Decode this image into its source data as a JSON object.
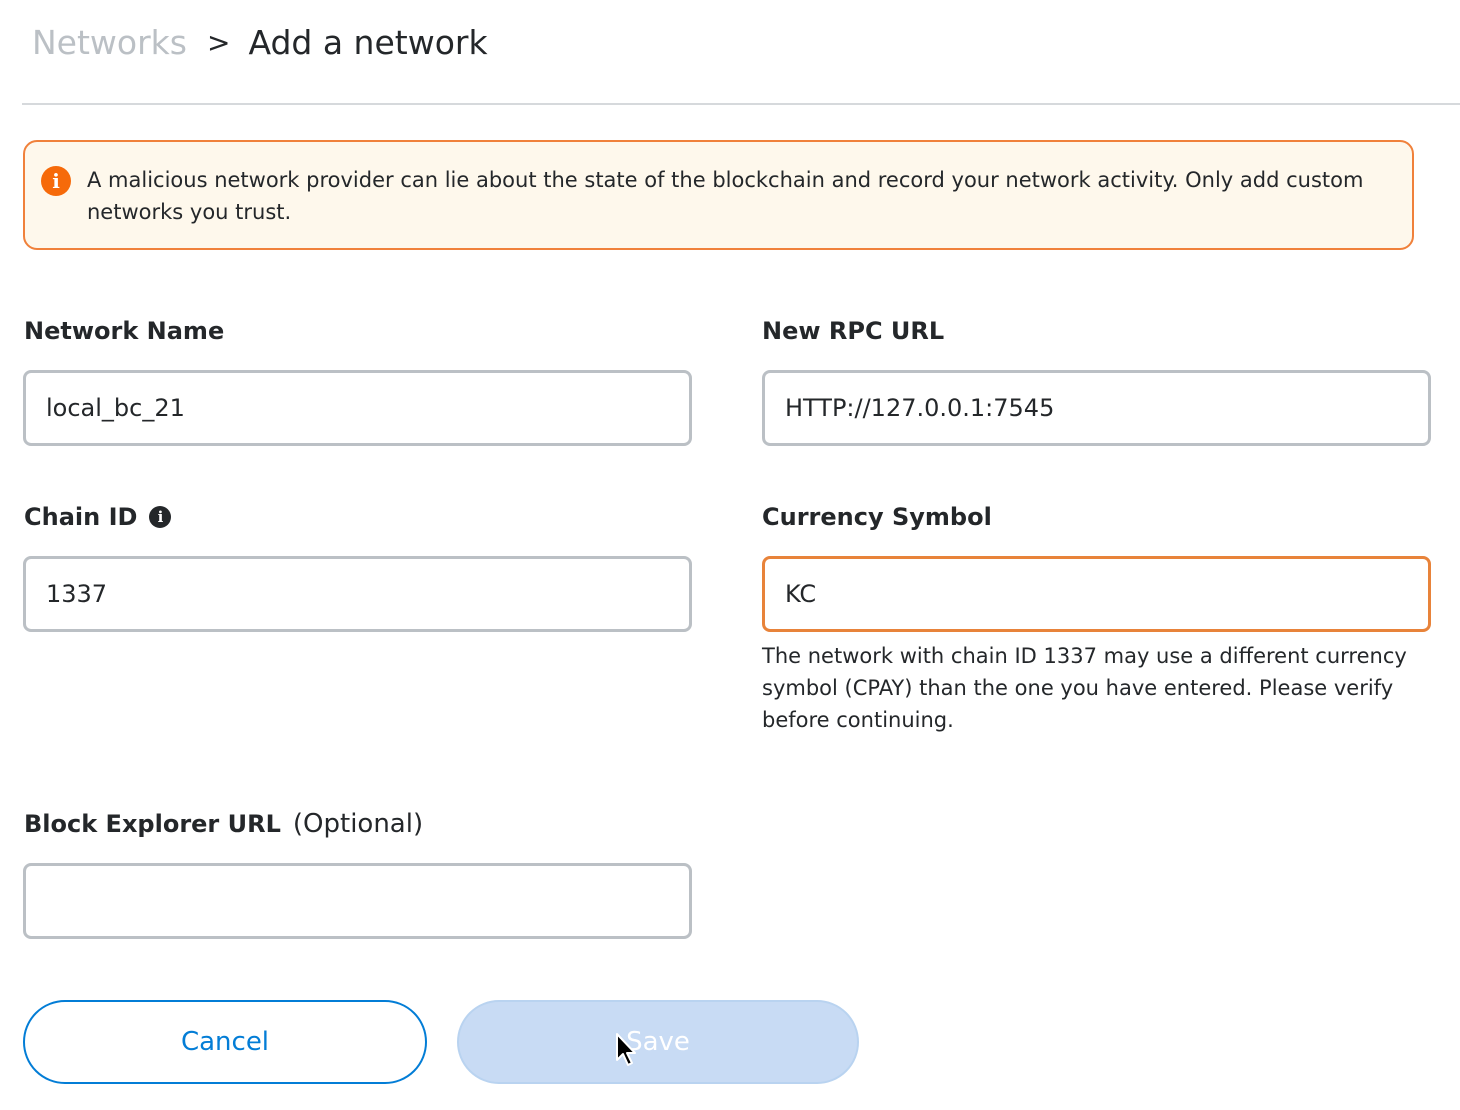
{
  "breadcrumb": {
    "parent": "Networks",
    "separator": ">",
    "current": "Add a network"
  },
  "warning": {
    "icon": "info-warning-icon",
    "text": "A malicious network provider can lie about the state of the blockchain and record your network activity. Only add custom networks you trust."
  },
  "fields": {
    "network_name": {
      "label": "Network Name",
      "value": "local_bc_21"
    },
    "rpc_url": {
      "label": "New RPC URL",
      "value": "HTTP://127.0.0.1:7545"
    },
    "chain_id": {
      "label": "Chain ID",
      "value": "1337"
    },
    "currency_symbol": {
      "label": "Currency Symbol",
      "value": "KC",
      "warning": "The network with chain ID 1337 may use a different currency symbol (CPAY) than the one you have entered. Please verify before continuing."
    },
    "block_explorer": {
      "label": "Block Explorer URL",
      "optional": "(Optional)",
      "value": ""
    }
  },
  "buttons": {
    "cancel": "Cancel",
    "save": "Save"
  },
  "colors": {
    "accent": "#037dd6",
    "warning_border": "#f0813b",
    "warning_bg": "#fef8ec",
    "disabled_button": "#c8dbf4"
  }
}
